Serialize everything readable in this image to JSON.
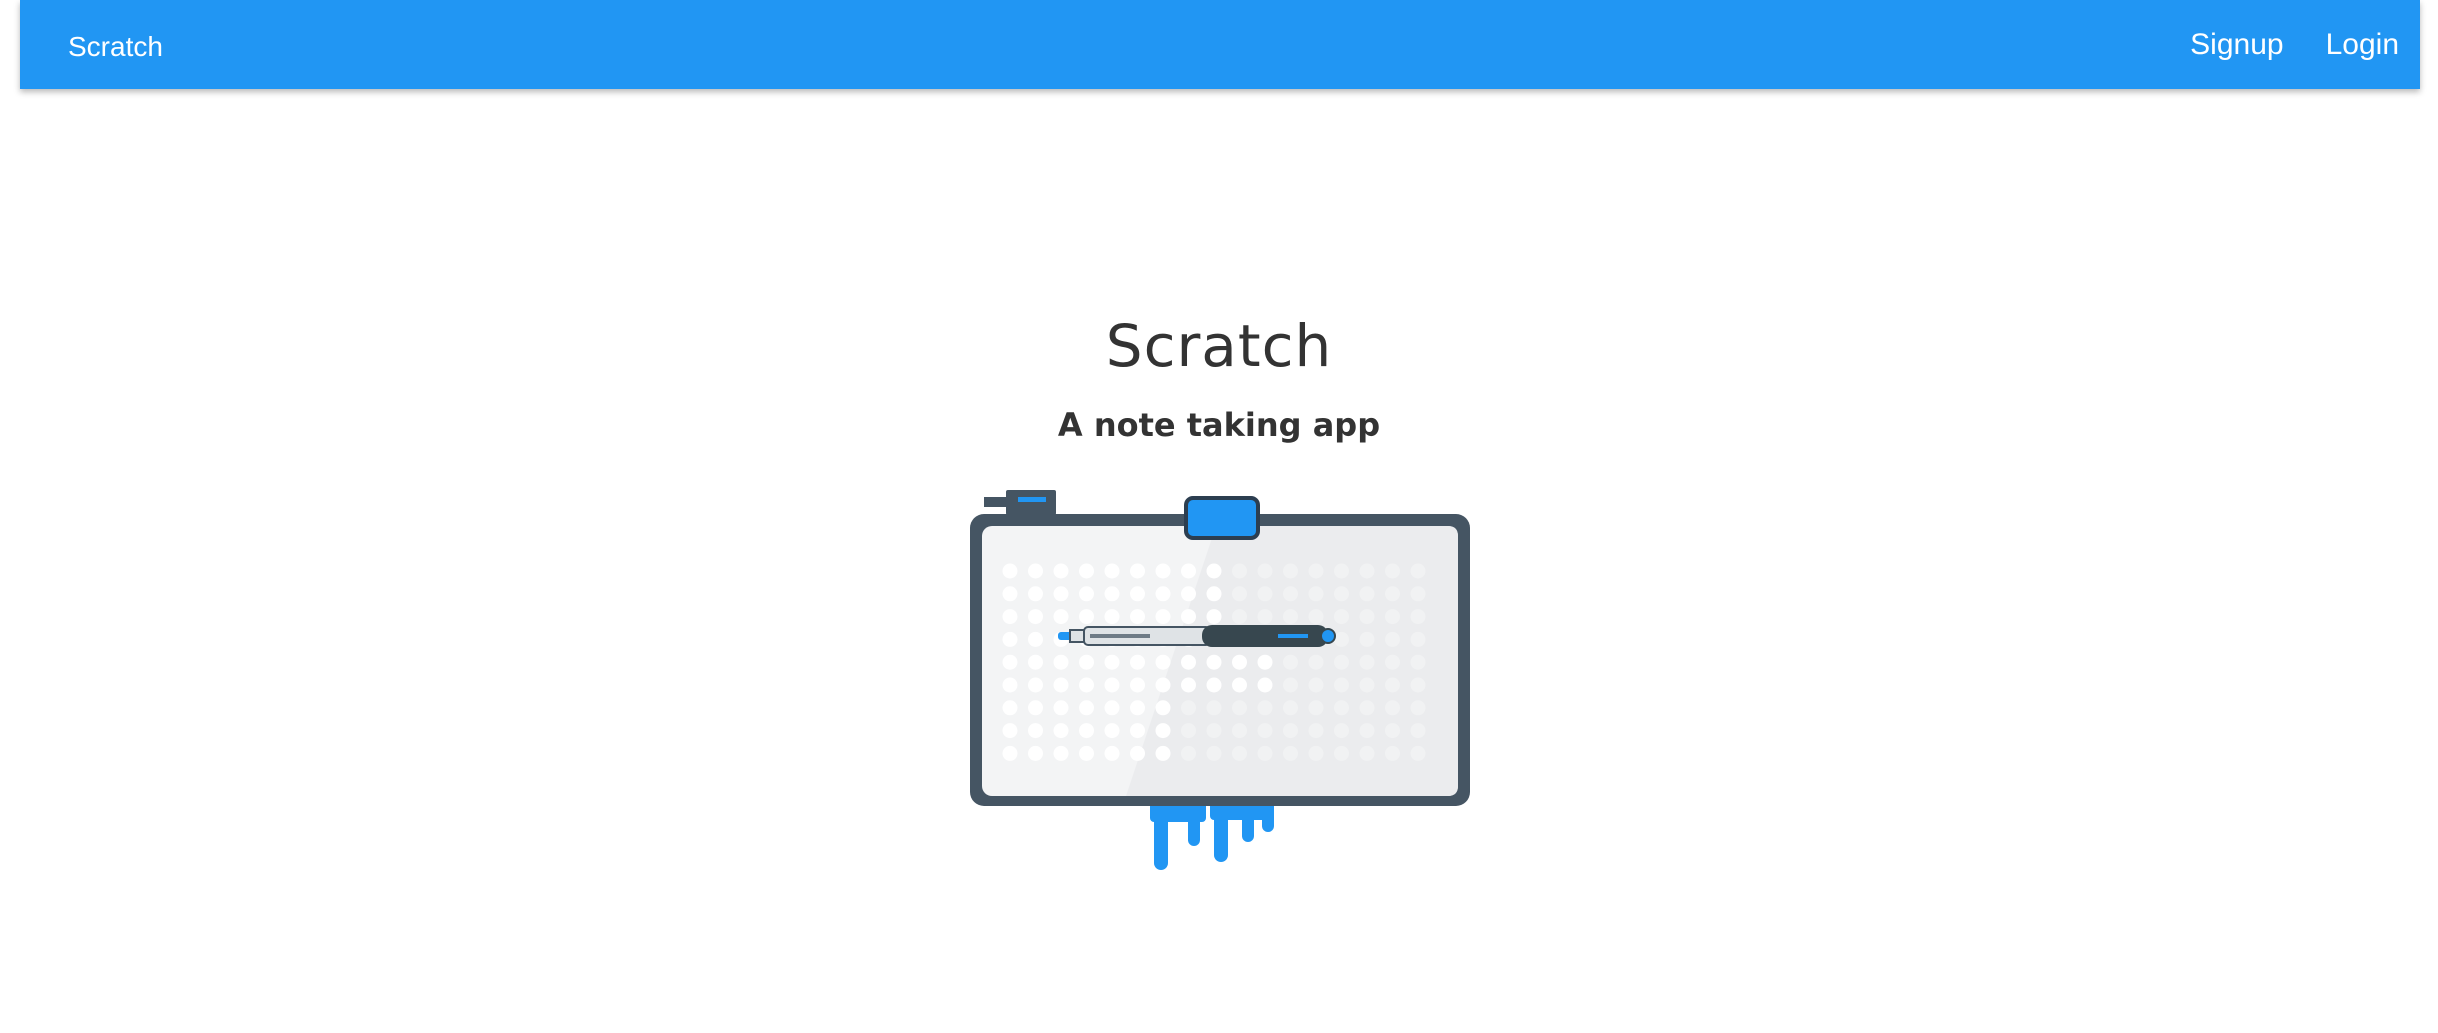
{
  "navbar": {
    "brand": "Scratch",
    "links": [
      {
        "label": "Signup"
      },
      {
        "label": "Login"
      }
    ],
    "color": "#2196f3"
  },
  "hero": {
    "title": "Scratch",
    "subtitle": "A note taking app",
    "illustration": "notepad-with-pen-illustration"
  },
  "colors": {
    "accent": "#2196f3",
    "text": "#333333",
    "frame": "#455563"
  }
}
